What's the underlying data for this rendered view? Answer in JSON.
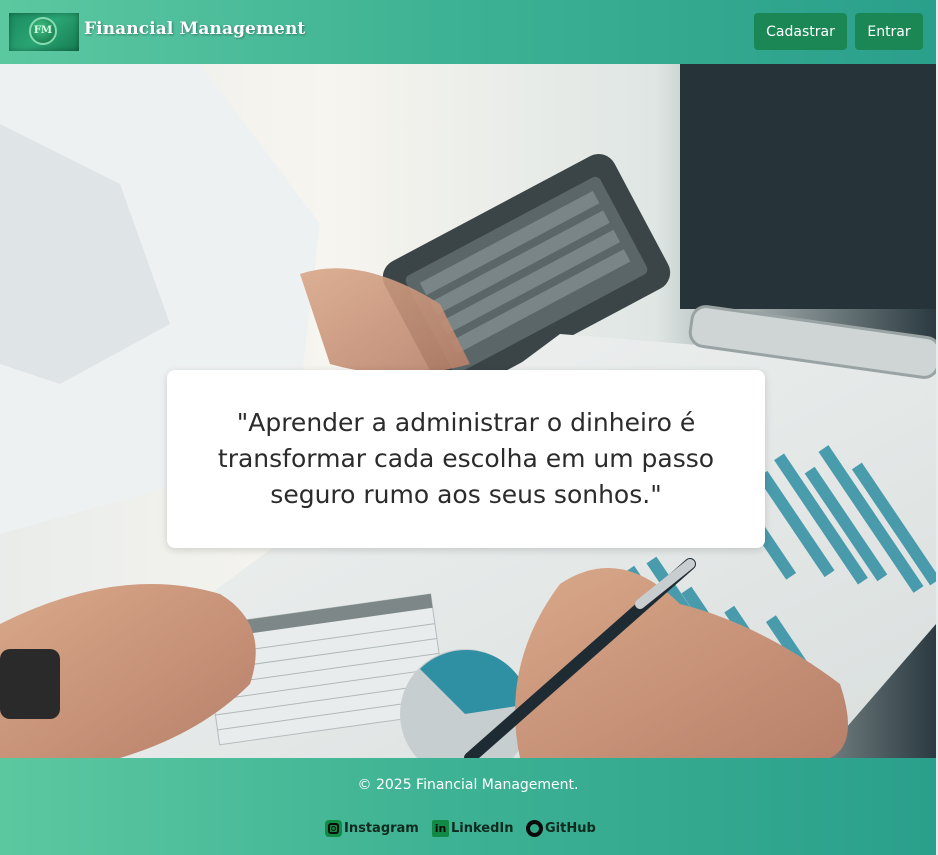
{
  "header": {
    "logo_mark": "FM",
    "brand": "Financial Management",
    "register_label": "Cadastrar",
    "login_label": "Entrar"
  },
  "hero": {
    "image": "photo of a person holding a calculator and a pen over printed financial charts on a clipboard",
    "quote": "\"Aprender a administrar o dinheiro é transformar cada escolha em um passo seguro rumo aos seus sonhos.\""
  },
  "footer": {
    "copyright": "© 2025 Financial Management.",
    "links": [
      {
        "label": "Instagram",
        "icon": "instagram-icon"
      },
      {
        "label": "LinkedIn",
        "icon": "linkedin-icon"
      },
      {
        "label": "GitHub",
        "icon": "github-icon"
      }
    ]
  },
  "colors": {
    "header_gradient_start": "#5cc8a0",
    "header_gradient_end": "#2a9f8b",
    "button_bg": "#1a8755",
    "chart_teal": "#2f8fa3"
  }
}
